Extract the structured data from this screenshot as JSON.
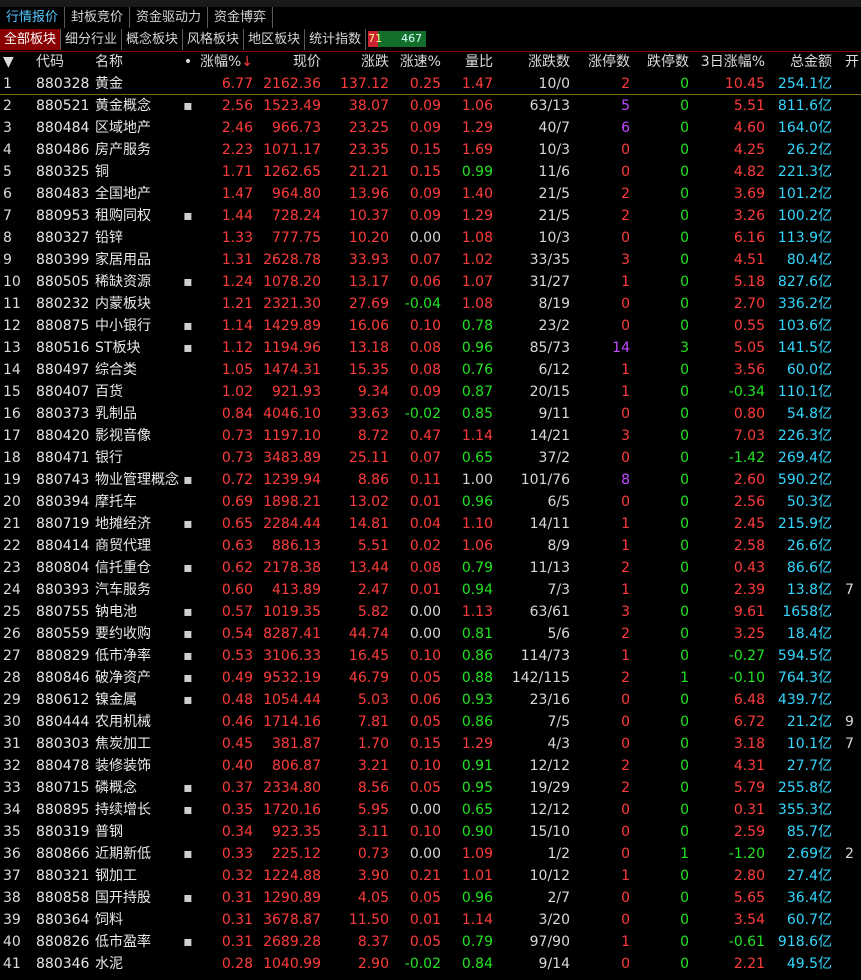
{
  "toolbar": {
    "label": "menu"
  },
  "tabs_top": [
    {
      "label": "行情报价",
      "active": true
    },
    {
      "label": "封板竞价",
      "active": false
    },
    {
      "label": "资金驱动力",
      "active": false
    },
    {
      "label": "资金博弈",
      "active": false
    }
  ],
  "tabs_board": [
    {
      "label": "全部板块",
      "active": true
    },
    {
      "label": "细分行业",
      "active": false
    },
    {
      "label": "概念板块",
      "active": false
    },
    {
      "label": "风格板块",
      "active": false
    },
    {
      "label": "地区板块",
      "active": false
    },
    {
      "label": "统计指数",
      "active": false
    }
  ],
  "breadth": {
    "up": "71",
    "down": "467"
  },
  "columns": {
    "sort": "▼",
    "code": "代码",
    "name": "名称",
    "dot": "•",
    "pct": "涨幅%",
    "price": "现价",
    "chg": "涨跌",
    "spd": "涨速%",
    "vr": "量比",
    "adv": "涨跌数",
    "zt": "涨停数",
    "dt": "跌停数",
    "p3": "3日涨幅%",
    "amt": "总金额",
    "open": "开"
  },
  "rows": [
    {
      "i": "1",
      "code": "880328",
      "name": "黄金",
      "dot": "",
      "pct": "6.77",
      "price": "2162.36",
      "chg": "137.12",
      "spd": "0.25",
      "vr": "1.47",
      "adv": "10/0",
      "zt": "2",
      "dt": "0",
      "p3": "10.45",
      "amt": "254.1亿",
      "open": ""
    },
    {
      "i": "2",
      "code": "880521",
      "name": "黄金概念",
      "dot": "▪",
      "pct": "2.56",
      "price": "1523.49",
      "chg": "38.07",
      "spd": "0.09",
      "vr": "1.06",
      "adv": "63/13",
      "zt": "5",
      "dt": "0",
      "p3": "5.51",
      "amt": "811.6亿",
      "open": ""
    },
    {
      "i": "3",
      "code": "880484",
      "name": "区域地产",
      "dot": "",
      "pct": "2.46",
      "price": "966.73",
      "chg": "23.25",
      "spd": "0.09",
      "vr": "1.29",
      "adv": "40/7",
      "zt": "6",
      "dt": "0",
      "p3": "4.60",
      "amt": "164.0亿",
      "open": ""
    },
    {
      "i": "4",
      "code": "880486",
      "name": "房产服务",
      "dot": "",
      "pct": "2.23",
      "price": "1071.17",
      "chg": "23.35",
      "spd": "0.15",
      "vr": "1.69",
      "adv": "10/3",
      "zt": "0",
      "dt": "0",
      "p3": "4.25",
      "amt": "26.2亿",
      "open": ""
    },
    {
      "i": "5",
      "code": "880325",
      "name": "铜",
      "dot": "",
      "pct": "1.71",
      "price": "1262.65",
      "chg": "21.21",
      "spd": "0.15",
      "vr": "0.99",
      "adv": "11/6",
      "zt": "0",
      "dt": "0",
      "p3": "4.82",
      "amt": "221.3亿",
      "open": ""
    },
    {
      "i": "6",
      "code": "880483",
      "name": "全国地产",
      "dot": "",
      "pct": "1.47",
      "price": "964.80",
      "chg": "13.96",
      "spd": "0.09",
      "vr": "1.40",
      "adv": "21/5",
      "zt": "2",
      "dt": "0",
      "p3": "3.69",
      "amt": "101.2亿",
      "open": ""
    },
    {
      "i": "7",
      "code": "880953",
      "name": "租购同权",
      "dot": "▪",
      "pct": "1.44",
      "price": "728.24",
      "chg": "10.37",
      "spd": "0.09",
      "vr": "1.29",
      "adv": "21/5",
      "zt": "2",
      "dt": "0",
      "p3": "3.26",
      "amt": "100.2亿",
      "open": ""
    },
    {
      "i": "8",
      "code": "880327",
      "name": "铅锌",
      "dot": "",
      "pct": "1.33",
      "price": "777.75",
      "chg": "10.20",
      "spd": "0.00",
      "vr": "1.08",
      "adv": "10/3",
      "zt": "0",
      "dt": "0",
      "p3": "6.16",
      "amt": "113.9亿",
      "open": ""
    },
    {
      "i": "9",
      "code": "880399",
      "name": "家居用品",
      "dot": "",
      "pct": "1.31",
      "price": "2628.78",
      "chg": "33.93",
      "spd": "0.07",
      "vr": "1.02",
      "adv": "33/35",
      "zt": "3",
      "dt": "0",
      "p3": "4.51",
      "amt": "80.4亿",
      "open": ""
    },
    {
      "i": "10",
      "code": "880505",
      "name": "稀缺资源",
      "dot": "▪",
      "pct": "1.24",
      "price": "1078.20",
      "chg": "13.17",
      "spd": "0.06",
      "vr": "1.07",
      "adv": "31/27",
      "zt": "1",
      "dt": "0",
      "p3": "5.18",
      "amt": "827.6亿",
      "open": ""
    },
    {
      "i": "11",
      "code": "880232",
      "name": "内蒙板块",
      "dot": "",
      "pct": "1.21",
      "price": "2321.30",
      "chg": "27.69",
      "spd": "-0.04",
      "vr": "1.08",
      "adv": "8/19",
      "zt": "0",
      "dt": "0",
      "p3": "2.70",
      "amt": "336.2亿",
      "open": ""
    },
    {
      "i": "12",
      "code": "880875",
      "name": "中小银行",
      "dot": "▪",
      "pct": "1.14",
      "price": "1429.89",
      "chg": "16.06",
      "spd": "0.10",
      "vr": "0.78",
      "adv": "23/2",
      "zt": "0",
      "dt": "0",
      "p3": "0.55",
      "amt": "103.6亿",
      "open": ""
    },
    {
      "i": "13",
      "code": "880516",
      "name": "ST板块",
      "dot": "▪",
      "pct": "1.12",
      "price": "1194.96",
      "chg": "13.18",
      "spd": "0.08",
      "vr": "0.96",
      "adv": "85/73",
      "zt": "14",
      "dt": "3",
      "p3": "5.05",
      "amt": "141.5亿",
      "open": ""
    },
    {
      "i": "14",
      "code": "880497",
      "name": "综合类",
      "dot": "",
      "pct": "1.05",
      "price": "1474.31",
      "chg": "15.35",
      "spd": "0.08",
      "vr": "0.76",
      "adv": "6/12",
      "zt": "1",
      "dt": "0",
      "p3": "3.56",
      "amt": "60.0亿",
      "open": ""
    },
    {
      "i": "15",
      "code": "880407",
      "name": "百货",
      "dot": "",
      "pct": "1.02",
      "price": "921.93",
      "chg": "9.34",
      "spd": "0.09",
      "vr": "0.87",
      "adv": "20/15",
      "zt": "1",
      "dt": "0",
      "p3": "-0.34",
      "amt": "110.1亿",
      "open": ""
    },
    {
      "i": "16",
      "code": "880373",
      "name": "乳制品",
      "dot": "",
      "pct": "0.84",
      "price": "4046.10",
      "chg": "33.63",
      "spd": "-0.02",
      "vr": "0.85",
      "adv": "9/11",
      "zt": "0",
      "dt": "0",
      "p3": "0.80",
      "amt": "54.8亿",
      "open": ""
    },
    {
      "i": "17",
      "code": "880420",
      "name": "影视音像",
      "dot": "",
      "pct": "0.73",
      "price": "1197.10",
      "chg": "8.72",
      "spd": "0.47",
      "vr": "1.14",
      "adv": "14/21",
      "zt": "3",
      "dt": "0",
      "p3": "7.03",
      "amt": "226.3亿",
      "open": ""
    },
    {
      "i": "18",
      "code": "880471",
      "name": "银行",
      "dot": "",
      "pct": "0.73",
      "price": "3483.89",
      "chg": "25.11",
      "spd": "0.07",
      "vr": "0.65",
      "adv": "37/2",
      "zt": "0",
      "dt": "0",
      "p3": "-1.42",
      "amt": "269.4亿",
      "open": ""
    },
    {
      "i": "19",
      "code": "880743",
      "name": "物业管理概念",
      "dot": "▪",
      "pct": "0.72",
      "price": "1239.94",
      "chg": "8.86",
      "spd": "0.11",
      "vr": "1.00",
      "adv": "101/76",
      "zt": "8",
      "dt": "0",
      "p3": "2.60",
      "amt": "590.2亿",
      "open": ""
    },
    {
      "i": "20",
      "code": "880394",
      "name": "摩托车",
      "dot": "",
      "pct": "0.69",
      "price": "1898.21",
      "chg": "13.02",
      "spd": "0.01",
      "vr": "0.96",
      "adv": "6/5",
      "zt": "0",
      "dt": "0",
      "p3": "2.56",
      "amt": "50.3亿",
      "open": ""
    },
    {
      "i": "21",
      "code": "880719",
      "name": "地摊经济",
      "dot": "▪",
      "pct": "0.65",
      "price": "2284.44",
      "chg": "14.81",
      "spd": "0.04",
      "vr": "1.10",
      "adv": "14/11",
      "zt": "1",
      "dt": "0",
      "p3": "2.45",
      "amt": "215.9亿",
      "open": ""
    },
    {
      "i": "22",
      "code": "880414",
      "name": "商贸代理",
      "dot": "",
      "pct": "0.63",
      "price": "886.13",
      "chg": "5.51",
      "spd": "0.02",
      "vr": "1.06",
      "adv": "8/9",
      "zt": "1",
      "dt": "0",
      "p3": "2.58",
      "amt": "26.6亿",
      "open": ""
    },
    {
      "i": "23",
      "code": "880804",
      "name": "信托重仓",
      "dot": "▪",
      "pct": "0.62",
      "price": "2178.38",
      "chg": "13.44",
      "spd": "0.08",
      "vr": "0.79",
      "adv": "11/13",
      "zt": "2",
      "dt": "0",
      "p3": "0.43",
      "amt": "86.6亿",
      "open": ""
    },
    {
      "i": "24",
      "code": "880393",
      "name": "汽车服务",
      "dot": "",
      "pct": "0.60",
      "price": "413.89",
      "chg": "2.47",
      "spd": "0.01",
      "vr": "0.94",
      "adv": "7/3",
      "zt": "1",
      "dt": "0",
      "p3": "2.39",
      "amt": "13.8亿",
      "open": "7"
    },
    {
      "i": "25",
      "code": "880755",
      "name": "钠电池",
      "dot": "▪",
      "pct": "0.57",
      "price": "1019.35",
      "chg": "5.82",
      "spd": "0.00",
      "vr": "1.13",
      "adv": "63/61",
      "zt": "3",
      "dt": "0",
      "p3": "9.61",
      "amt": "1658亿",
      "open": ""
    },
    {
      "i": "26",
      "code": "880559",
      "name": "要约收购",
      "dot": "▪",
      "pct": "0.54",
      "price": "8287.41",
      "chg": "44.74",
      "spd": "0.00",
      "vr": "0.81",
      "adv": "5/6",
      "zt": "2",
      "dt": "0",
      "p3": "3.25",
      "amt": "18.4亿",
      "open": ""
    },
    {
      "i": "27",
      "code": "880829",
      "name": "低市净率",
      "dot": "▪",
      "pct": "0.53",
      "price": "3106.33",
      "chg": "16.45",
      "spd": "0.10",
      "vr": "0.86",
      "adv": "114/73",
      "zt": "1",
      "dt": "0",
      "p3": "-0.27",
      "amt": "594.5亿",
      "open": ""
    },
    {
      "i": "28",
      "code": "880846",
      "name": "破净资产",
      "dot": "▪",
      "pct": "0.49",
      "price": "9532.19",
      "chg": "46.79",
      "spd": "0.05",
      "vr": "0.88",
      "adv": "142/115",
      "zt": "2",
      "dt": "1",
      "p3": "-0.10",
      "amt": "764.3亿",
      "open": ""
    },
    {
      "i": "29",
      "code": "880612",
      "name": "镍金属",
      "dot": "▪",
      "pct": "0.48",
      "price": "1054.44",
      "chg": "5.03",
      "spd": "0.06",
      "vr": "0.93",
      "adv": "23/16",
      "zt": "0",
      "dt": "0",
      "p3": "6.48",
      "amt": "439.7亿",
      "open": ""
    },
    {
      "i": "30",
      "code": "880444",
      "name": "农用机械",
      "dot": "",
      "pct": "0.46",
      "price": "1714.16",
      "chg": "7.81",
      "spd": "0.05",
      "vr": "0.86",
      "adv": "7/5",
      "zt": "0",
      "dt": "0",
      "p3": "6.72",
      "amt": "21.2亿",
      "open": "9"
    },
    {
      "i": "31",
      "code": "880303",
      "name": "焦炭加工",
      "dot": "",
      "pct": "0.45",
      "price": "381.87",
      "chg": "1.70",
      "spd": "0.15",
      "vr": "1.29",
      "adv": "4/3",
      "zt": "0",
      "dt": "0",
      "p3": "3.18",
      "amt": "10.1亿",
      "open": "7"
    },
    {
      "i": "32",
      "code": "880478",
      "name": "装修装饰",
      "dot": "",
      "pct": "0.40",
      "price": "806.87",
      "chg": "3.21",
      "spd": "0.10",
      "vr": "0.91",
      "adv": "12/12",
      "zt": "2",
      "dt": "0",
      "p3": "4.31",
      "amt": "27.7亿",
      "open": ""
    },
    {
      "i": "33",
      "code": "880715",
      "name": "磷概念",
      "dot": "▪",
      "pct": "0.37",
      "price": "2334.80",
      "chg": "8.56",
      "spd": "0.05",
      "vr": "0.95",
      "adv": "19/29",
      "zt": "2",
      "dt": "0",
      "p3": "5.79",
      "amt": "255.8亿",
      "open": ""
    },
    {
      "i": "34",
      "code": "880895",
      "name": "持续增长",
      "dot": "▪",
      "pct": "0.35",
      "price": "1720.16",
      "chg": "5.95",
      "spd": "0.00",
      "vr": "0.65",
      "adv": "12/12",
      "zt": "0",
      "dt": "0",
      "p3": "0.31",
      "amt": "355.3亿",
      "open": ""
    },
    {
      "i": "35",
      "code": "880319",
      "name": "普钢",
      "dot": "",
      "pct": "0.34",
      "price": "923.35",
      "chg": "3.11",
      "spd": "0.10",
      "vr": "0.90",
      "adv": "15/10",
      "zt": "0",
      "dt": "0",
      "p3": "2.59",
      "amt": "85.7亿",
      "open": ""
    },
    {
      "i": "36",
      "code": "880866",
      "name": "近期新低",
      "dot": "▪",
      "pct": "0.33",
      "price": "225.12",
      "chg": "0.73",
      "spd": "0.00",
      "vr": "1.09",
      "adv": "1/2",
      "zt": "0",
      "dt": "1",
      "p3": "-1.20",
      "amt": "2.69亿",
      "open": "2"
    },
    {
      "i": "37",
      "code": "880321",
      "name": "钢加工",
      "dot": "",
      "pct": "0.32",
      "price": "1224.88",
      "chg": "3.90",
      "spd": "0.21",
      "vr": "1.01",
      "adv": "10/12",
      "zt": "1",
      "dt": "0",
      "p3": "2.80",
      "amt": "27.4亿",
      "open": ""
    },
    {
      "i": "38",
      "code": "880858",
      "name": "国开持股",
      "dot": "▪",
      "pct": "0.31",
      "price": "1290.89",
      "chg": "4.05",
      "spd": "0.05",
      "vr": "0.96",
      "adv": "2/7",
      "zt": "0",
      "dt": "0",
      "p3": "5.65",
      "amt": "36.4亿",
      "open": ""
    },
    {
      "i": "39",
      "code": "880364",
      "name": "饲料",
      "dot": "",
      "pct": "0.31",
      "price": "3678.87",
      "chg": "11.50",
      "spd": "0.01",
      "vr": "1.14",
      "adv": "3/20",
      "zt": "0",
      "dt": "0",
      "p3": "3.54",
      "amt": "60.7亿",
      "open": ""
    },
    {
      "i": "40",
      "code": "880826",
      "name": "低市盈率",
      "dot": "▪",
      "pct": "0.31",
      "price": "2689.28",
      "chg": "8.37",
      "spd": "0.05",
      "vr": "0.79",
      "adv": "97/90",
      "zt": "1",
      "dt": "0",
      "p3": "-0.61",
      "amt": "918.6亿",
      "open": ""
    },
    {
      "i": "41",
      "code": "880346",
      "name": "水泥",
      "dot": "",
      "pct": "0.28",
      "price": "1040.99",
      "chg": "2.90",
      "spd": "-0.02",
      "vr": "0.84",
      "adv": "9/14",
      "zt": "0",
      "dt": "0",
      "p3": "2.21",
      "amt": "49.5亿",
      "open": ""
    }
  ],
  "colors": {
    "up": "#ff3b3b",
    "down": "#22e322",
    "flat": "#d6d6d6",
    "amount": "#33d7ff",
    "limit": "#c04bff"
  }
}
